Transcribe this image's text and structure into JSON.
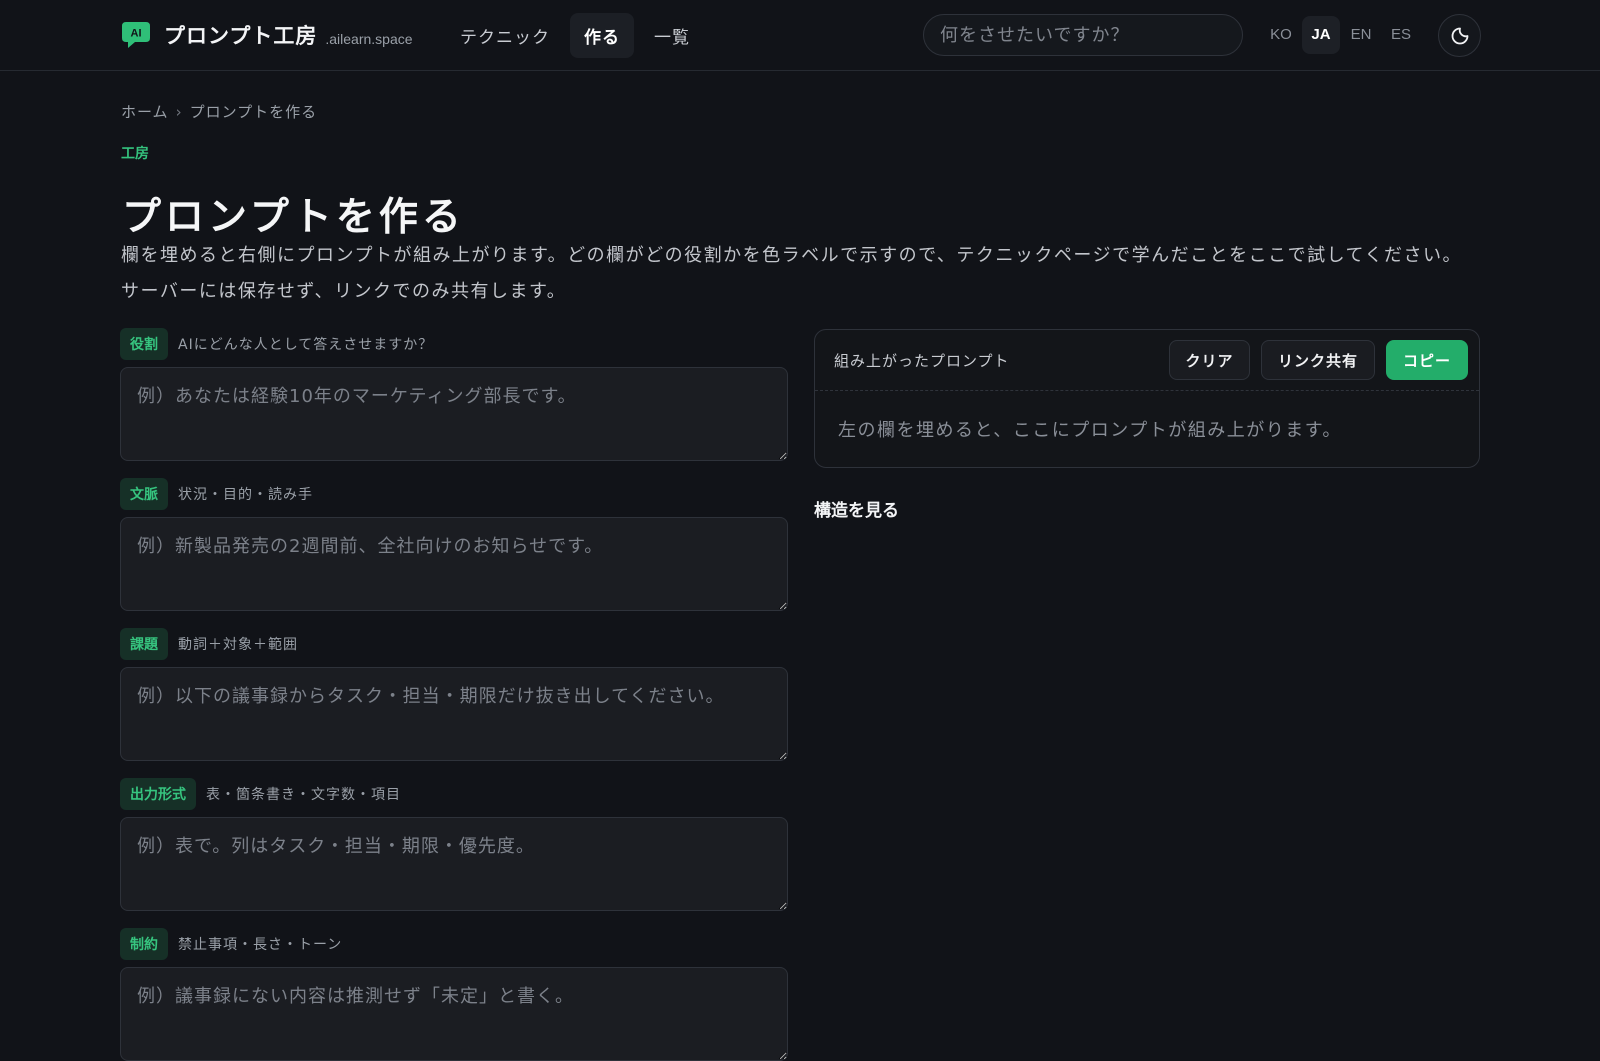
{
  "header": {
    "brand": "プロンプト工房",
    "domain": ".ailearn.space",
    "logo_icon": "ai-chat-bubble-icon",
    "nav": [
      "テクニック",
      "作る",
      "一覧"
    ],
    "nav_active": "作る",
    "search_placeholder": "何をさせたいですか？",
    "langs": [
      "KO",
      "JA",
      "EN",
      "ES"
    ],
    "lang_active": "JA",
    "theme_icon": "moon-icon"
  },
  "breadcrumb": {
    "home": "ホーム",
    "separator": "›",
    "current": "プロンプトを作る"
  },
  "eyebrow": "工房",
  "title": "プロンプトを作る",
  "lede": "欄を埋めると右側にプロンプトが組み上がります。どの欄がどの役割かを色ラベルで示すので、テクニックページで学んだことをここで試してください。サーバーには保存せず、リンクでのみ共有します。",
  "fields": [
    {
      "tag": "役割",
      "hint": "AIにどんな人として答えさせますか？",
      "placeholder": "例）あなたは経験10年のマーケティング部長です。"
    },
    {
      "tag": "文脈",
      "hint": "状況・目的・読み手",
      "placeholder": "例）新製品発売の2週間前、全社向けのお知らせです。"
    },
    {
      "tag": "課題",
      "hint": "動詞＋対象＋範囲",
      "placeholder": "例）以下の議事録からタスク・担当・期限だけ抜き出してください。"
    },
    {
      "tag": "出力形式",
      "hint": "表・箇条書き・文字数・項目",
      "placeholder": "例）表で。列はタスク・担当・期限・優先度。"
    },
    {
      "tag": "制約",
      "hint": "禁止事項・長さ・トーン",
      "placeholder": "例）議事録にない内容は推測せず「未定」と書く。"
    }
  ],
  "output": {
    "title": "組み上がったプロンプト",
    "clear_label": "クリア",
    "share_label": "リンク共有",
    "copy_label": "コピー",
    "empty_text": "左の欄を埋めると、ここにプロンプトが組み上がります。"
  },
  "structure_label": "構造を見る",
  "colors": {
    "accent": "#23ad6a",
    "background": "#111318",
    "tag_bg": "#163027"
  }
}
